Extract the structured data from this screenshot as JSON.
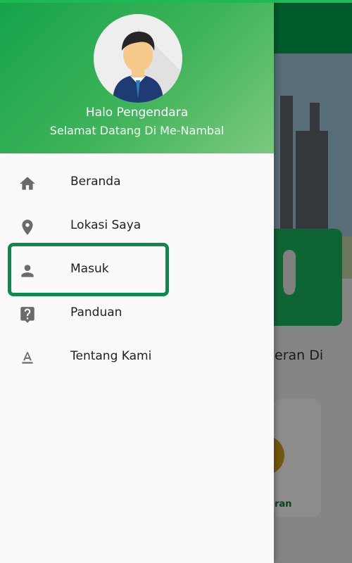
{
  "header": {
    "greeting": "Halo Pengendara",
    "welcome": "Selamat Datang Di Me-Nambal"
  },
  "menu": [
    {
      "label": "Beranda",
      "icon": "home-icon"
    },
    {
      "label": "Lokasi Saya",
      "icon": "location-pin-icon"
    },
    {
      "label": "Masuk",
      "icon": "person-icon",
      "highlighted": true
    },
    {
      "label": "Panduan",
      "icon": "help-icon"
    },
    {
      "label": "Tentang Kami",
      "icon": "text-format-icon"
    }
  ],
  "background": {
    "section_title_fragment": "eran Di",
    "tile_label_fragment": "ran"
  },
  "colors": {
    "brand_green": "#15a34a",
    "highlight_border": "#0c8a4b",
    "icon_gray": "#6b6b6b"
  }
}
